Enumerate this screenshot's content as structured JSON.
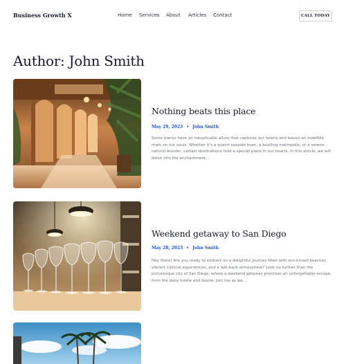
{
  "header": {
    "brand": "Business Growth X",
    "nav": [
      "Home",
      "Services",
      "About",
      "Articles",
      "Contact"
    ],
    "cta": "CALL TODAY"
  },
  "page": {
    "title": "Author: John Smith"
  },
  "posts": [
    {
      "title": "Nothing beats this place",
      "date": "May 29, 2023",
      "author": "John Smith",
      "excerpt": "Some places have an inexplicable allure that captures our hearts and leaves an indelible mark on our souls. Whether it’s a quaint seaside town, a bustling metropolis, or a serene natural wonder, certain destinations hold a special place in our hearts. In this article, we will delve into the enchantment…"
    },
    {
      "title": "Weekend getaway to San Diego",
      "date": "May 28, 2023",
      "author": "John Smith",
      "excerpt": "Hey there! Are you ready to embark on a delightful journey filled with sun-kissed beaches, vibrant cultural experiences, and a laid-back atmosphere? Look no further than the picturesque city of San Diego, where a weekend getaway promises an unforgettable escape from the daily hustle and bustle. Join me as we…"
    }
  ]
}
